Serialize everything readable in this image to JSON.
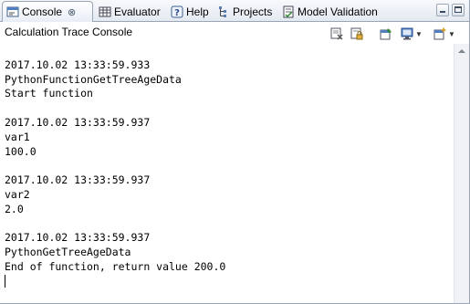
{
  "tabs": [
    {
      "label": "Console",
      "icon": "console-icon",
      "active": true,
      "closable": true
    },
    {
      "label": "Evaluator",
      "icon": "grid-icon"
    },
    {
      "label": "Help",
      "icon": "help-icon"
    },
    {
      "label": "Projects",
      "icon": "projects-icon"
    },
    {
      "label": "Model Validation",
      "icon": "validation-icon"
    }
  ],
  "tab_close_glyph": "⊗",
  "console": {
    "name": "Calculation Trace Console"
  },
  "output": [
    {
      "text": ""
    },
    {
      "text": "2017.10.02 13:33:59.933"
    },
    {
      "text": "PythonFunctionGetTreeAgeData"
    },
    {
      "text": "Start function"
    },
    {
      "text": ""
    },
    {
      "text": "2017.10.02 13:33:59.937"
    },
    {
      "text": "var1"
    },
    {
      "text": "100.0"
    },
    {
      "text": ""
    },
    {
      "text": "2017.10.02 13:33:59.937"
    },
    {
      "text": "var2"
    },
    {
      "text": "2.0"
    },
    {
      "text": ""
    },
    {
      "text": "2017.10.02 13:33:59.937"
    },
    {
      "text": "PythonGetTreeAgeData"
    },
    {
      "text": "End of function, return value 200.0"
    }
  ],
  "colors": {
    "accent": "#2b5da8",
    "border": "#9aa6b6"
  }
}
